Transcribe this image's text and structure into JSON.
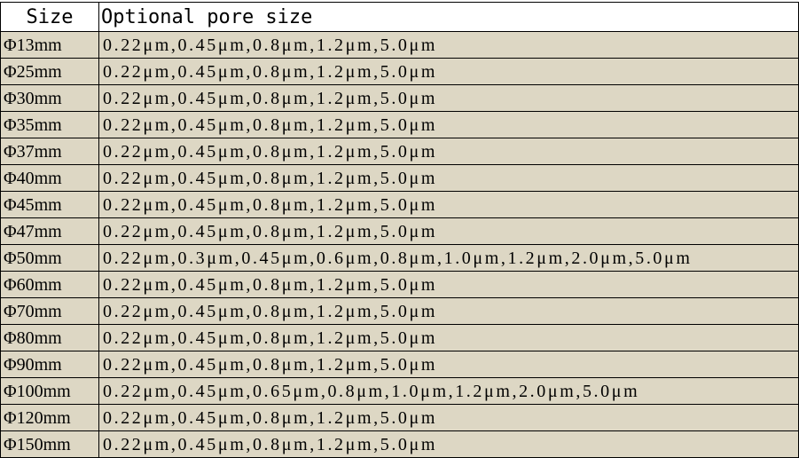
{
  "table": {
    "headers": {
      "size": "Size",
      "pore": "Optional pore size"
    },
    "rows": [
      {
        "size": "Φ13mm",
        "pores": "0.22μm,0.45μm,0.8μm,1.2μm,5.0μm"
      },
      {
        "size": "Φ25mm",
        "pores": "0.22μm,0.45μm,0.8μm,1.2μm,5.0μm"
      },
      {
        "size": "Φ30mm",
        "pores": "0.22μm,0.45μm,0.8μm,1.2μm,5.0μm"
      },
      {
        "size": "Φ35mm",
        "pores": "0.22μm,0.45μm,0.8μm,1.2μm,5.0μm"
      },
      {
        "size": "Φ37mm",
        "pores": "0.22μm,0.45μm,0.8μm,1.2μm,5.0μm"
      },
      {
        "size": "Φ40mm",
        "pores": "0.22μm,0.45μm,0.8μm,1.2μm,5.0μm"
      },
      {
        "size": "Φ45mm",
        "pores": "0.22μm,0.45μm,0.8μm,1.2μm,5.0μm"
      },
      {
        "size": "Φ47mm",
        "pores": "0.22μm,0.45μm,0.8μm,1.2μm,5.0μm"
      },
      {
        "size": "Φ50mm",
        "pores": "0.22μm,0.3μm,0.45μm,0.6μm,0.8μm,1.0μm,1.2μm,2.0μm,5.0μm"
      },
      {
        "size": "Φ60mm",
        "pores": "0.22μm,0.45μm,0.8μm,1.2μm,5.0μm"
      },
      {
        "size": "Φ70mm",
        "pores": "0.22μm,0.45μm,0.8μm,1.2μm,5.0μm"
      },
      {
        "size": "Φ80mm",
        "pores": "0.22μm,0.45μm,0.8μm,1.2μm,5.0μm"
      },
      {
        "size": "Φ90mm",
        "pores": "0.22μm,0.45μm,0.8μm,1.2μm,5.0μm"
      },
      {
        "size": "Φ100mm",
        "pores": "0.22μm,0.45μm,0.65μm,0.8μm,1.0μm,1.2μm,2.0μm,5.0μm"
      },
      {
        "size": "Φ120mm",
        "pores": "0.22μm,0.45μm,0.8μm,1.2μm,5.0μm"
      },
      {
        "size": "Φ150mm",
        "pores": "0.22μm,0.45μm,0.8μm,1.2μm,5.0μm"
      }
    ]
  },
  "colors": {
    "row_background": "#ddd7c4",
    "header_background": "#ffffff",
    "border": "#000000"
  }
}
